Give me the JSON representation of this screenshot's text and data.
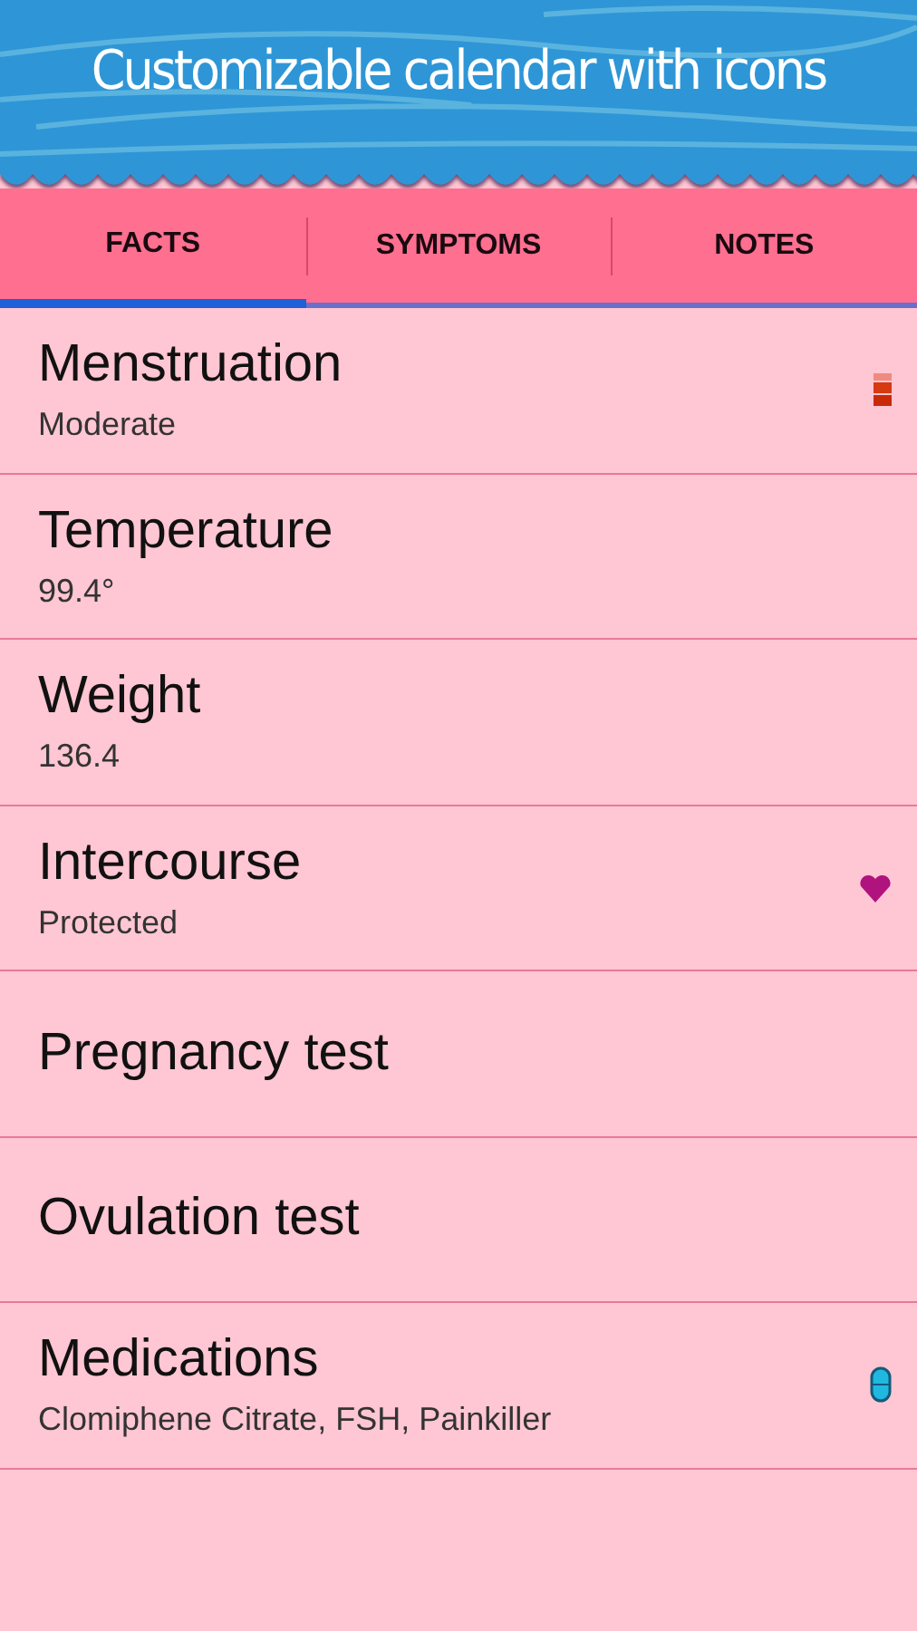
{
  "header": {
    "title": "Customizable calendar with icons"
  },
  "tabs": [
    {
      "label": "FACTS",
      "selected": true
    },
    {
      "label": "SYMPTOMS",
      "selected": false
    },
    {
      "label": "NOTES",
      "selected": false
    }
  ],
  "facts": [
    {
      "title": "Menstruation",
      "value": "Moderate",
      "kind": "flow"
    },
    {
      "title": "Temperature",
      "value": "99.4°",
      "kind": "plain"
    },
    {
      "title": "Weight",
      "value": "136.4",
      "kind": "plain"
    },
    {
      "title": "Intercourse",
      "value": "Protected",
      "kind": "heart"
    },
    {
      "title": "Pregnancy test",
      "kind": "plain"
    },
    {
      "title": "Ovulation test",
      "kind": "plain"
    },
    {
      "title": "Medications",
      "value": "Clomiphene Citrate, FSH, Painkiller",
      "kind": "pill"
    }
  ]
}
